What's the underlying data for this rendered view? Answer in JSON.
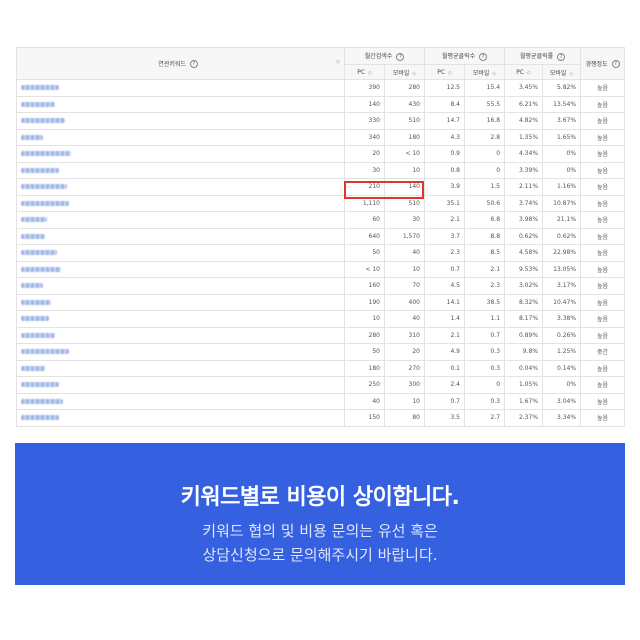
{
  "table": {
    "headers": {
      "keyword": "연관키워드",
      "monthly_search": "월간검색수",
      "avg_clicks": "월평균클릭수",
      "avg_ctr": "월평균클릭률",
      "competition": "경쟁정도",
      "pc": "PC",
      "mobile": "모바일"
    },
    "rows": [
      {
        "kw_len": 38,
        "search_pc": "390",
        "search_mo": "280",
        "click_pc": "12.5",
        "click_mo": "15.4",
        "ctr_pc": "3.45%",
        "ctr_mo": "5.82%",
        "comp": "높음"
      },
      {
        "kw_len": 34,
        "search_pc": "140",
        "search_mo": "430",
        "click_pc": "8.4",
        "click_mo": "55.5",
        "ctr_pc": "6.21%",
        "ctr_mo": "13.54%",
        "comp": "높음"
      },
      {
        "kw_len": 44,
        "search_pc": "330",
        "search_mo": "510",
        "click_pc": "14.7",
        "click_mo": "16.8",
        "ctr_pc": "4.82%",
        "ctr_mo": "3.67%",
        "comp": "높음"
      },
      {
        "kw_len": 22,
        "search_pc": "340",
        "search_mo": "180",
        "click_pc": "4.3",
        "click_mo": "2.8",
        "ctr_pc": "1.35%",
        "ctr_mo": "1.65%",
        "comp": "높음"
      },
      {
        "kw_len": 50,
        "search_pc": "20",
        "search_mo": "< 10",
        "click_pc": "0.9",
        "click_mo": "0",
        "ctr_pc": "4.34%",
        "ctr_mo": "0%",
        "comp": "높음"
      },
      {
        "kw_len": 38,
        "search_pc": "30",
        "search_mo": "10",
        "click_pc": "0.8",
        "click_mo": "0",
        "ctr_pc": "3.39%",
        "ctr_mo": "0%",
        "comp": "높음"
      },
      {
        "kw_len": 46,
        "search_pc": "210",
        "search_mo": "140",
        "click_pc": "3.9",
        "click_mo": "1.5",
        "ctr_pc": "2.11%",
        "ctr_mo": "1.16%",
        "comp": "높음"
      },
      {
        "kw_len": 48,
        "search_pc": "1,110",
        "search_mo": "510",
        "click_pc": "35.1",
        "click_mo": "50.6",
        "ctr_pc": "3.74%",
        "ctr_mo": "10.87%",
        "comp": "높음"
      },
      {
        "kw_len": 26,
        "search_pc": "60",
        "search_mo": "30",
        "click_pc": "2.1",
        "click_mo": "6.8",
        "ctr_pc": "3.98%",
        "ctr_mo": "21.1%",
        "comp": "높음"
      },
      {
        "kw_len": 24,
        "search_pc": "640",
        "search_mo": "1,570",
        "click_pc": "3.7",
        "click_mo": "8.8",
        "ctr_pc": "0.62%",
        "ctr_mo": "0.62%",
        "comp": "높음"
      },
      {
        "kw_len": 36,
        "search_pc": "50",
        "search_mo": "40",
        "click_pc": "2.3",
        "click_mo": "8.5",
        "ctr_pc": "4.58%",
        "ctr_mo": "22.98%",
        "comp": "높음"
      },
      {
        "kw_len": 40,
        "search_pc": "< 10",
        "search_mo": "10",
        "click_pc": "0.7",
        "click_mo": "2.1",
        "ctr_pc": "9.53%",
        "ctr_mo": "13.05%",
        "comp": "높음"
      },
      {
        "kw_len": 22,
        "search_pc": "160",
        "search_mo": "70",
        "click_pc": "4.5",
        "click_mo": "2.3",
        "ctr_pc": "3.02%",
        "ctr_mo": "3.17%",
        "comp": "높음"
      },
      {
        "kw_len": 30,
        "search_pc": "190",
        "search_mo": "400",
        "click_pc": "14.1",
        "click_mo": "38.5",
        "ctr_pc": "8.32%",
        "ctr_mo": "10.47%",
        "comp": "높음"
      },
      {
        "kw_len": 28,
        "search_pc": "10",
        "search_mo": "40",
        "click_pc": "1.4",
        "click_mo": "1.1",
        "ctr_pc": "8.17%",
        "ctr_mo": "3.38%",
        "comp": "높음"
      },
      {
        "kw_len": 34,
        "search_pc": "280",
        "search_mo": "310",
        "click_pc": "2.1",
        "click_mo": "0.7",
        "ctr_pc": "0.89%",
        "ctr_mo": "0.26%",
        "comp": "높음"
      },
      {
        "kw_len": 48,
        "search_pc": "50",
        "search_mo": "20",
        "click_pc": "4.9",
        "click_mo": "0.3",
        "ctr_pc": "9.8%",
        "ctr_mo": "1.25%",
        "comp": "중간"
      },
      {
        "kw_len": 24,
        "search_pc": "180",
        "search_mo": "270",
        "click_pc": "0.1",
        "click_mo": "0.3",
        "ctr_pc": "0.04%",
        "ctr_mo": "0.14%",
        "comp": "높음"
      },
      {
        "kw_len": 38,
        "search_pc": "250",
        "search_mo": "300",
        "click_pc": "2.4",
        "click_mo": "0",
        "ctr_pc": "1.05%",
        "ctr_mo": "0%",
        "comp": "높음"
      },
      {
        "kw_len": 42,
        "search_pc": "40",
        "search_mo": "10",
        "click_pc": "0.7",
        "click_mo": "0.3",
        "ctr_pc": "1.67%",
        "ctr_mo": "3.04%",
        "comp": "높음"
      },
      {
        "kw_len": 38,
        "search_pc": "150",
        "search_mo": "80",
        "click_pc": "3.5",
        "click_mo": "2.7",
        "ctr_pc": "2.37%",
        "ctr_mo": "3.34%",
        "comp": "높음"
      }
    ]
  },
  "banner": {
    "headline": "키워드별로 비용이 상이합니다.",
    "sub_line1": "키워드 협의 및 비용 문의는 유선 혹은",
    "sub_line2": "상담신청으로 문의해주시기 바랍니다."
  },
  "colors": {
    "banner_bg": "#3560e0",
    "highlight": "#e0342c"
  }
}
